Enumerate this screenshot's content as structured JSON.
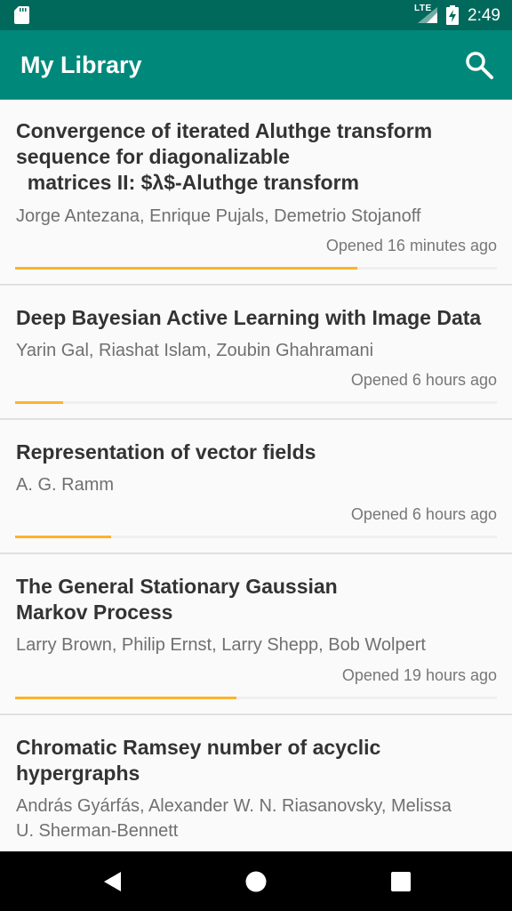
{
  "status_bar": {
    "time": "2:49",
    "network": "LTE"
  },
  "app_bar": {
    "title": "My Library",
    "search_icon": "search-icon"
  },
  "items": [
    {
      "title_lines": [
        "Convergence of iterated Aluthge transform",
        "sequence for diagonalizable",
        "  matrices II: $λ$-Aluthge transform"
      ],
      "authors": "Jorge Antezana, Enrique Pujals, Demetrio Stojanoff",
      "opened": "Opened 16 minutes ago",
      "progress": 0.71
    },
    {
      "title_lines": [
        "Deep Bayesian Active Learning with Image Data"
      ],
      "authors": "Yarin Gal, Riashat Islam, Zoubin Ghahramani",
      "opened": "Opened 6 hours ago",
      "progress": 0.1
    },
    {
      "title_lines": [
        "Representation of vector fields"
      ],
      "authors": "A. G. Ramm",
      "opened": "Opened 6 hours ago",
      "progress": 0.2
    },
    {
      "title_lines": [
        "The General Stationary Gaussian",
        "Markov Process"
      ],
      "authors": "Larry Brown, Philip Ernst, Larry Shepp, Bob Wolpert",
      "opened": "Opened 19 hours ago",
      "progress": 0.46
    },
    {
      "title_lines": [
        "Chromatic Ramsey number of acyclic",
        "hypergraphs"
      ],
      "authors_lines": [
        "András Gyárfás, Alexander W. N. Riasanovsky, Melissa",
        "U. Sherman-Bennett"
      ],
      "opened": "",
      "progress": 0
    }
  ],
  "colors": {
    "status_bar": "#00695c",
    "app_bar": "#00897b",
    "progress": "#fbb42b"
  }
}
